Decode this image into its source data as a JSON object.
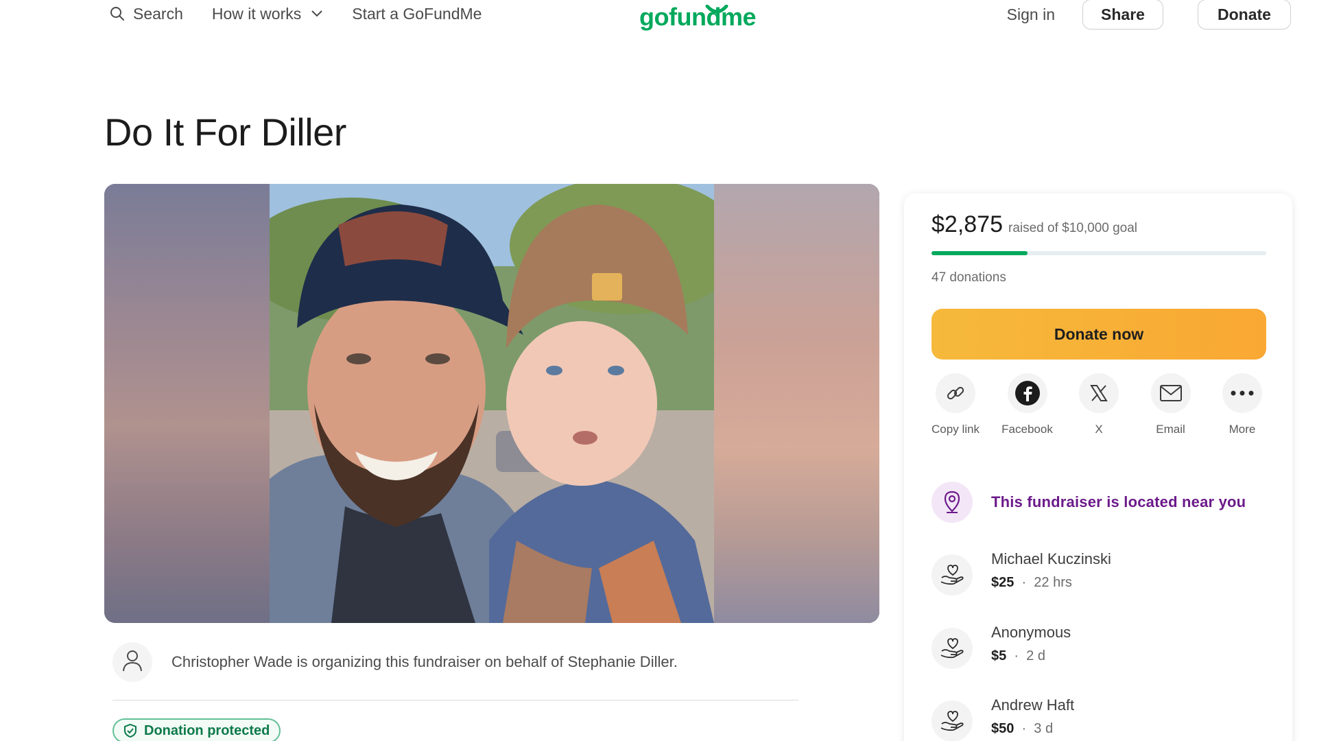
{
  "header": {
    "search_label": "Search",
    "how_it_works_label": "How it works",
    "start_label": "Start a GoFundMe",
    "logo_text": "gofundme",
    "sign_in_label": "Sign in",
    "share_label": "Share",
    "donate_label": "Donate"
  },
  "campaign": {
    "title": "Do It For Diller",
    "organizer_text": "Christopher Wade is organizing this fundraiser on behalf of Stephanie Diller.",
    "protected_label": "Donation protected"
  },
  "sidebar": {
    "raised_amount": "$2,875",
    "raised_goal_text": "raised of $10,000 goal",
    "progress_fraction": 0.2875,
    "donations_count": "47 donations",
    "donate_now_label": "Donate now",
    "share_options": [
      {
        "label": "Copy link",
        "icon": "link-icon"
      },
      {
        "label": "Facebook",
        "icon": "facebook-icon"
      },
      {
        "label": "X",
        "icon": "x-icon"
      },
      {
        "label": "Email",
        "icon": "email-icon"
      },
      {
        "label": "More",
        "icon": "more-icon"
      }
    ],
    "near_you_text": "This fundraiser is located near you",
    "donors": [
      {
        "name": "Michael Kuczinski",
        "amount": "$25",
        "time": "22 hrs"
      },
      {
        "name": "Anonymous",
        "amount": "$5",
        "time": "2 d"
      },
      {
        "name": "Andrew Haft",
        "amount": "$50",
        "time": "3 d"
      }
    ]
  },
  "colors": {
    "brand_green": "#02a95c",
    "donate_orange": "#f9a833",
    "near_purple": "#6c1b8a"
  }
}
